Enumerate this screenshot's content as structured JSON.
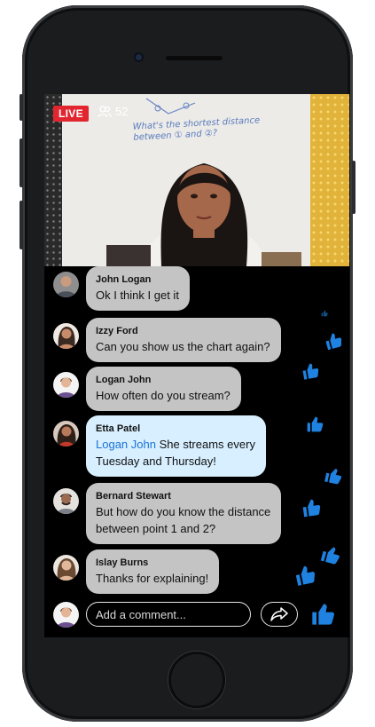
{
  "stream": {
    "live_label": "LIVE",
    "viewer_count": "52",
    "whiteboard_text_1": "What's the shortest distance",
    "whiteboard_text_2": "between ① and ②?"
  },
  "messages": [
    {
      "name": "John Logan",
      "text": "Ok I think I get it"
    },
    {
      "name": "Izzy Ford",
      "text": "Can you show us the chart again?"
    },
    {
      "name": "Logan John",
      "text": "How often do you stream?"
    },
    {
      "name": "Etta Patel",
      "mention": "Logan John",
      "text_line1": "She streams every",
      "text_line2": "Tuesday and Thursday!"
    },
    {
      "name": "Bernard Stewart",
      "text_line1": "But how do you know the distance",
      "text_line2": "between point 1 and 2?"
    },
    {
      "name": "Islay Burns",
      "text": "Thanks for explaining!"
    }
  ],
  "composer": {
    "placeholder": "Add a comment..."
  },
  "colors": {
    "live": "#e1262f",
    "thumb": "#1f82e0",
    "mention": "#1b73d6",
    "highlight_bubble": "#d7efff",
    "bubble": "#c4c4c4"
  }
}
